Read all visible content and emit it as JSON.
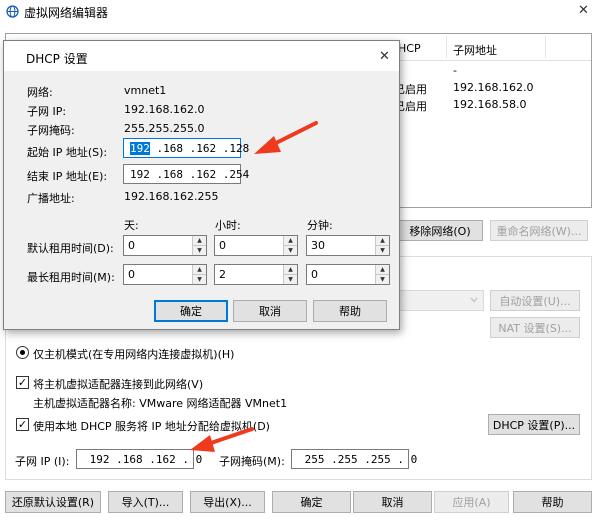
{
  "window": {
    "title": "虚拟网络编辑器",
    "close_glyph": "✕"
  },
  "table": {
    "col_dhcp": "HCP",
    "col_subnet": "子网地址",
    "rows": [
      {
        "dhcp": "",
        "subnet": "-"
      },
      {
        "dhcp": "已启用",
        "subnet": "192.168.162.0"
      },
      {
        "dhcp": "已启用",
        "subnet": "192.168.58.0"
      }
    ]
  },
  "main": {
    "remove_network": "移除网络(O)",
    "rename_network": "重命名网络(W)...",
    "auto_settings": "自动设置(U)...",
    "nat_settings": "NAT 设置(S)...",
    "host_only_mode": "仅主机模式(在专用网络内连接虚拟机)(H)",
    "connect_adapter": "将主机虚拟适配器连接到此网络(V)",
    "adapter_name_label": "主机虚拟适配器名称: VMware 网络适配器 VMnet1",
    "use_dhcp": "使用本地 DHCP 服务将 IP 地址分配给虚拟机(D)",
    "dhcp_settings": "DHCP 设置(P)...",
    "subnet_ip_label": "子网 IP (I):",
    "subnet_ip_value": " 192 .168 .162 . 0",
    "subnet_mask_label": "子网掩码(M):",
    "subnet_mask_value": " 255 .255 .255 . 0"
  },
  "footer": {
    "restore": "还原默认设置(R)",
    "import": "导入(T)...",
    "export": "导出(X)...",
    "ok": "确定",
    "cancel": "取消",
    "apply": "应用(A)",
    "help": "帮助"
  },
  "dialog": {
    "title": "DHCP 设置",
    "close_glyph": "✕",
    "network_label": "网络:",
    "network_value": "vmnet1",
    "subnet_ip_label": "子网 IP:",
    "subnet_ip_value": "192.168.162.0",
    "subnet_mask_label": "子网掩码:",
    "subnet_mask_value": "255.255.255.0",
    "start_ip_label": "起始 IP 地址(S):",
    "start_ip_first": "192",
    "start_ip_rest": " .168 .162 .128",
    "end_ip_label": "结束 IP 地址(E):",
    "end_ip_value": "192 .168 .162 .254",
    "broadcast_label": "广播地址:",
    "broadcast_value": "192.168.162.255",
    "col_days": "天:",
    "col_hours": "小时:",
    "col_minutes": "分钟:",
    "default_lease_label": "默认租用时间(D):",
    "default_days": "0",
    "default_hours": "0",
    "default_minutes": "30",
    "max_lease_label": "最长租用时间(M):",
    "max_days": "0",
    "max_hours": "2",
    "max_minutes": "0",
    "ok": "确定",
    "cancel": "取消",
    "help": "帮助"
  },
  "colors": {
    "accent": "#0078d7",
    "annotation_arrow": "#f03a1e"
  }
}
